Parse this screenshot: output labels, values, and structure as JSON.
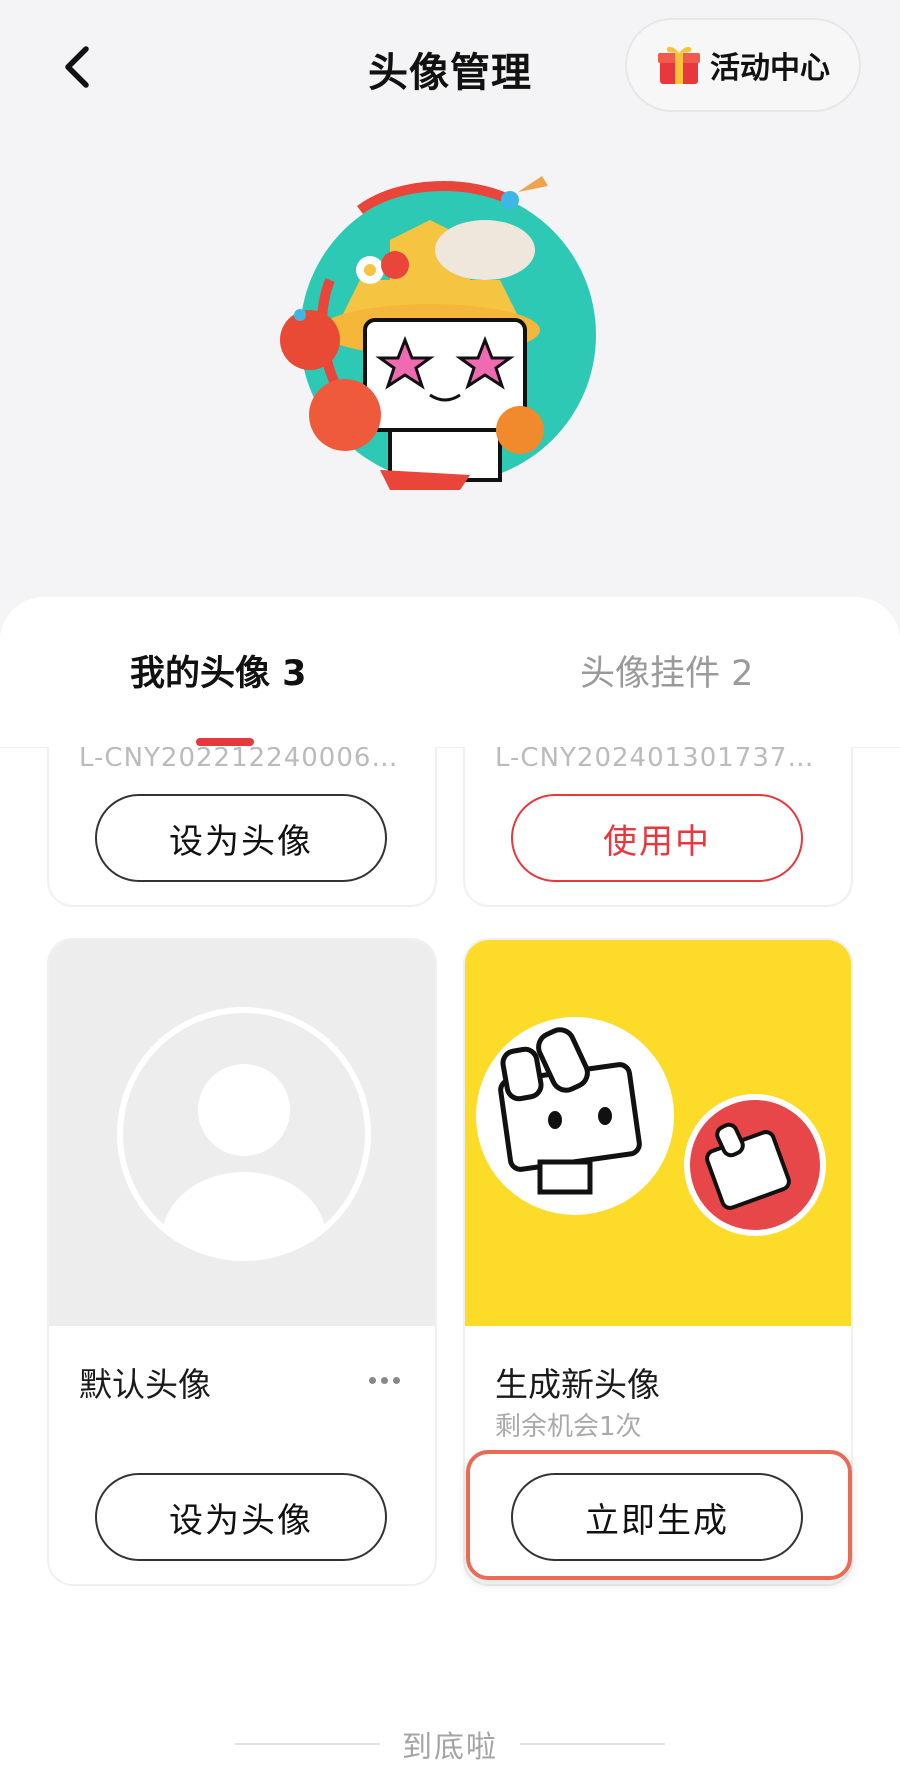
{
  "header": {
    "title": "头像管理",
    "activity_label": "活动中心"
  },
  "tabs": {
    "mine": "我的头像 3",
    "pendant": "头像挂件 2"
  },
  "cards": [
    {
      "id_text": "L-CNY2022122400060...",
      "button": "设为头像"
    },
    {
      "id_text": "L-CNY202401301737O...",
      "button": "使用中"
    },
    {
      "title": "默认头像",
      "button": "设为头像"
    },
    {
      "title": "生成新头像",
      "subtitle": "剩余机会1次",
      "button": "立即生成"
    }
  ],
  "footer": {
    "text": "到底啦"
  },
  "colors": {
    "accent": "#e8383d",
    "highlight": "#e96a55",
    "generate_bg": "#fcdb29"
  },
  "icons": [
    "back-arrow-icon",
    "gift-icon",
    "more-icon",
    "default-person-icon"
  ]
}
